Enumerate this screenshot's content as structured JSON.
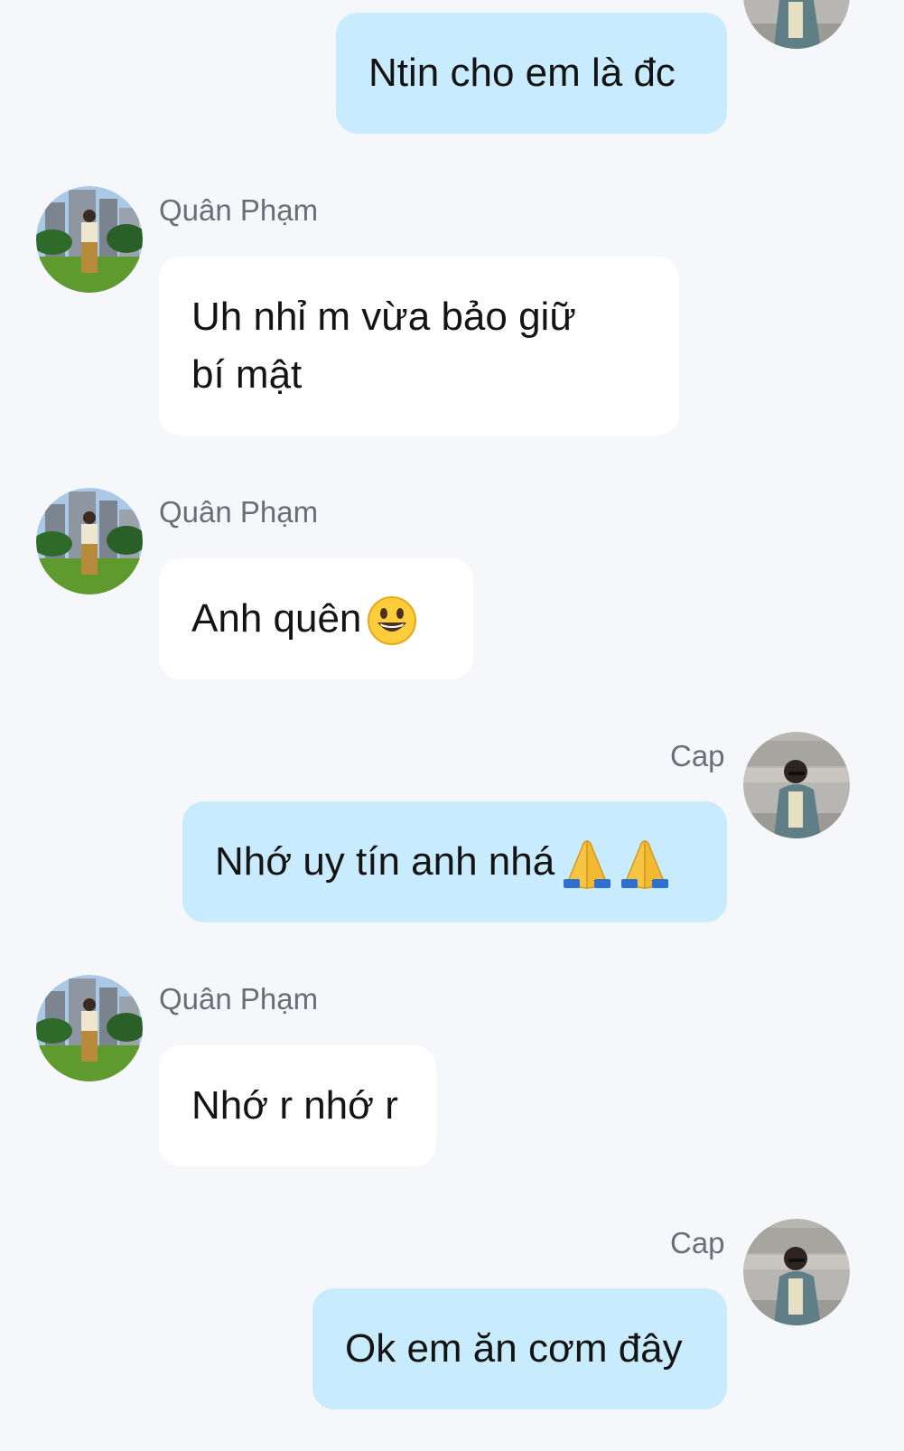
{
  "messages": [
    {
      "side": "me",
      "text": "Ntin cho em là đc"
    },
    {
      "side": "them",
      "sender": "Quân Phạm",
      "text_line1": "Uh nhỉ m vừa bảo giữ",
      "text_line2": "bí mật"
    },
    {
      "side": "them",
      "sender": "Quân Phạm",
      "text": "Anh quên",
      "emoji": "grinning-face-emoji"
    },
    {
      "side": "me",
      "sender": "Cap",
      "text": "Nhớ uy tín anh nhá",
      "emoji": "folded-hands-emoji"
    },
    {
      "side": "them",
      "sender": "Quân Phạm",
      "text": "Nhớ r nhớ r"
    },
    {
      "side": "me",
      "sender": "Cap",
      "text": "Ok em ăn cơm đây"
    }
  ],
  "colors": {
    "background": "#f5f7fa",
    "my_bubble": "#c8ecfd",
    "their_bubble": "#ffffff",
    "sender_name": "#6a6f75"
  }
}
